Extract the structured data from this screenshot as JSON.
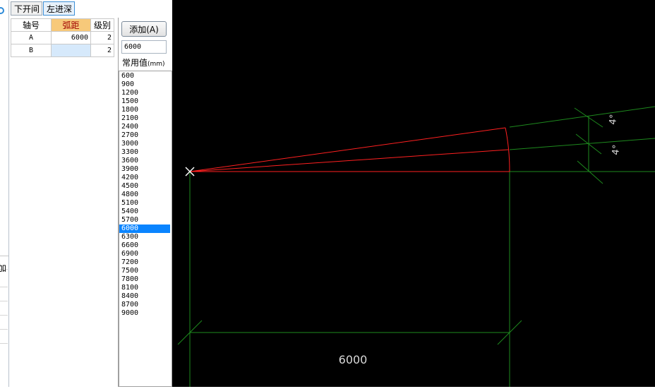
{
  "left_strip": {
    "visible_char": "加"
  },
  "tabs": [
    {
      "label": "下开间",
      "active": false
    },
    {
      "label": "左进深",
      "active": true
    }
  ],
  "table": {
    "headers": [
      "轴号",
      "弧距",
      "级别"
    ],
    "rows": [
      {
        "axis": "A",
        "distance": "6000",
        "level": "2"
      },
      {
        "axis": "B",
        "distance": "",
        "level": "2"
      }
    ]
  },
  "add_button": {
    "label": "添加(A)"
  },
  "value_input": {
    "value": "6000"
  },
  "common_values": {
    "label": "常用值",
    "unit": "(mm)",
    "items": [
      "600",
      "900",
      "1200",
      "1500",
      "1800",
      "2100",
      "2400",
      "2700",
      "3000",
      "3300",
      "3600",
      "3900",
      "4200",
      "4500",
      "4800",
      "5100",
      "5400",
      "5700",
      "6000",
      "6300",
      "6600",
      "6900",
      "7200",
      "7500",
      "7800",
      "8100",
      "8400",
      "8700",
      "9000"
    ],
    "selected": "6000"
  },
  "canvas": {
    "dimension_label": "6000",
    "angle_label_1": "4°",
    "angle_label_2": "4°",
    "colors": {
      "background": "#000000",
      "axis": "#ff2020",
      "dimension": "#1e8a1e",
      "text": "#d8d8d8",
      "origin": "#ffffff"
    }
  }
}
